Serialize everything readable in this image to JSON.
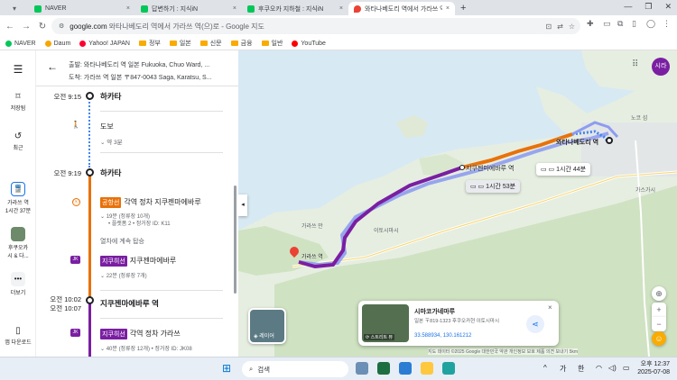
{
  "tabs": [
    {
      "label": "NAVER",
      "color": "#03c75a"
    },
    {
      "label": "답변하기 : 지식iN",
      "color": "#03c75a"
    },
    {
      "label": "후쿠오카 지하철 : 지식iN",
      "color": "#03c75a"
    },
    {
      "label": "와타나베도리 역에서 가라쓰 역",
      "color": "#34a853",
      "active": true
    }
  ],
  "address": {
    "host": "google.com",
    "rest": "와타나베도리 역에서 가라쓰 역(으)로 - Google 지도"
  },
  "bookmarks": [
    {
      "label": "NAVER",
      "type": "site",
      "color": "#03c75a"
    },
    {
      "label": "Daum",
      "type": "site",
      "color": "#f7a600"
    },
    {
      "label": "Yahoo! JAPAN",
      "type": "site",
      "color": "#ff0033"
    },
    {
      "label": "정부",
      "type": "folder"
    },
    {
      "label": "일본",
      "type": "folder"
    },
    {
      "label": "신문",
      "type": "folder"
    },
    {
      "label": "금융",
      "type": "folder"
    },
    {
      "label": "일반",
      "type": "folder"
    },
    {
      "label": "YouTube",
      "type": "site",
      "color": "#ff0000"
    }
  ],
  "rail": {
    "saved": "저장됨",
    "recent": "최근",
    "route_a": "가라쓰 역",
    "route_b": "1시간 37분",
    "place_a": "후쿠오카",
    "place_b": "시 & 다...",
    "more": "더보기",
    "download": "앱 다운로드"
  },
  "directions": {
    "origin": "출발: 와타나베도리 역 일본 Fukuoka, Chuo Ward, ...",
    "destination": "도착: 가라쓰 역 일본 〒847-0043 Saga, Karatsu, S..."
  },
  "timeline": {
    "t1": "오전 9:15",
    "s1": "하카타",
    "walk": "도보",
    "walk_dur": "약 3분",
    "t2": "오전 9:19",
    "s2": "하카타",
    "airport_badge": "공항선",
    "airport_line": "각역 정차 지쿠젠마에바루",
    "airport_detail1": "19분 (정류장 10개)",
    "airport_detail2": "• 플랫폼 2 • 정거장 ID: K11",
    "stay": "열차에 계속 탑승",
    "chikuhi_badge": "지쿠히선",
    "chikuhi_line": "지쿠젠마에바루",
    "chikuhi_detail": "22분 (정류장 7개)",
    "t3": "오전 10:02",
    "t4": "오전 10:07",
    "s3": "지쿠젠마에바루 역",
    "chikuhi2_badge": "지쿠히선",
    "chikuhi2_line": "각역 정차 가라쓰",
    "chikuhi2_detail": "40분 (정류장 12개) • 정거장 ID: JK08",
    "jk_label": "JK"
  },
  "map": {
    "label_start": "와타나베도리 역",
    "label_mid": "지쿠젠마에바루 역",
    "label_end": "가라쓰 역",
    "time_1": "1시간 44분",
    "time_2": "1시간 53분",
    "layer": "레이어",
    "account": "시라",
    "place_noko": "노코 섬",
    "place_kasuga": "가스가시",
    "place_itoshima": "이토시마시",
    "place_karatsu_bay": "가라쓰 만",
    "card_title": "시마코가네마루",
    "card_address": "일본 〒819-1323 후쿠오카현 이토시마시",
    "card_coords": "33.588934, 130.161212",
    "card_street": "스트리트 뷰",
    "footer": "지도 데이터 ©2025 Google   대한민국   약관   개인정보 보호   제품 의견 보내기   5km"
  },
  "taskbar": {
    "search": "검색",
    "ime1": "가",
    "ime2": "한",
    "time": "오후 12:37",
    "date": "2025-07-08"
  },
  "colors": {
    "walk": "#4285f4",
    "airport": "#e8710a",
    "chikuhi": "#7b1fa2"
  }
}
